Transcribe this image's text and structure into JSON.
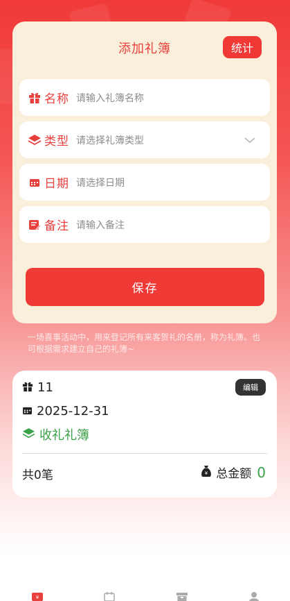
{
  "form": {
    "title": "添加礼簿",
    "stats_label": "统计",
    "fields": [
      {
        "icon": "gift-icon",
        "label": "名称",
        "placeholder": "请输入礼簿名称"
      },
      {
        "icon": "layers-icon",
        "label": "类型",
        "placeholder": "请选择礼簿类型"
      },
      {
        "icon": "calendar-icon",
        "label": "日期",
        "placeholder": "请选择日期"
      },
      {
        "icon": "note-icon",
        "label": "备注",
        "placeholder": "请输入备注"
      }
    ],
    "save_label": "保存"
  },
  "description": "一场喜事活动中，用来登记所有来客贺礼的名册，称为礼簿。也可根据需求建立自己的礼簿~",
  "book": {
    "name": "11",
    "edit_label": "编辑",
    "date": "2025-12-31",
    "type": "收礼礼簿",
    "count": "共0笔",
    "total_label": "总金额",
    "total_amount": "0"
  },
  "colors": {
    "accent": "#ef3a36",
    "card_bg": "#f9efdb",
    "green": "#3aa148"
  }
}
